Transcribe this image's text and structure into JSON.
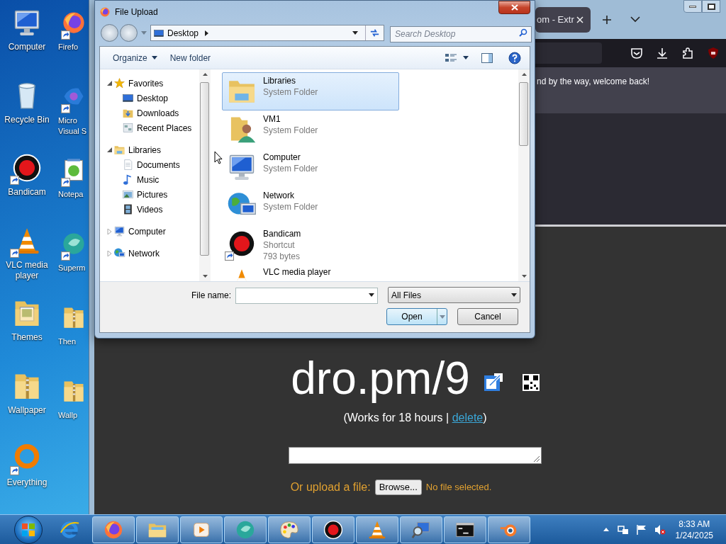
{
  "desktop": {
    "icons": [
      {
        "label": "Computer",
        "kind": "computer",
        "shortcut": false
      },
      {
        "label": "Recycle Bin",
        "kind": "recycle",
        "shortcut": false
      },
      {
        "label": "Bandicam",
        "kind": "bandicam",
        "shortcut": true
      },
      {
        "label": "VLC media player",
        "kind": "vlc",
        "shortcut": true
      },
      {
        "label": "Themes",
        "kind": "photo-folder",
        "shortcut": false
      },
      {
        "label": "Wallpaper",
        "kind": "zip-folder",
        "shortcut": false
      },
      {
        "label": "Everything",
        "kind": "everything",
        "shortcut": true
      }
    ],
    "partial_icons": [
      {
        "label": "Firefo",
        "kind": "firefox",
        "shortcut": true
      },
      {
        "label": "Micro Visual S",
        "kind": "vscode",
        "shortcut": true
      },
      {
        "label": "Notepa",
        "kind": "notepad",
        "shortcut": true
      },
      {
        "label": "Superm",
        "kind": "supermium",
        "shortcut": true
      },
      {
        "label": "Then",
        "kind": "zip-folder",
        "shortcut": false
      },
      {
        "label": "Wallp",
        "kind": "zip-folder",
        "shortcut": false
      }
    ]
  },
  "browser": {
    "tab": {
      "title": "om - Extr"
    },
    "notification": "nd by the way, welcome back!",
    "page": {
      "short_link": "dro.pm/9",
      "expiry_prefix": "(Works for 18 hours | ",
      "delete_link": "delete",
      "expiry_suffix": ")",
      "upload_label": "Or upload a file:",
      "browse_button": "Browse...",
      "file_status": "No file selected."
    }
  },
  "dialog": {
    "title": "File Upload",
    "location": "Desktop",
    "search_placeholder": "Search Desktop",
    "toolbar": [
      {
        "label": "Organize",
        "has_menu": true
      },
      {
        "label": "New folder",
        "has_menu": false
      }
    ],
    "nav": [
      {
        "label": "Favorites",
        "kind": "star",
        "expanded": true,
        "children": [
          {
            "label": "Desktop",
            "kind": "desktop"
          },
          {
            "label": "Downloads",
            "kind": "downloads"
          },
          {
            "label": "Recent Places",
            "kind": "recent"
          }
        ]
      },
      {
        "label": "Libraries",
        "kind": "library",
        "expanded": true,
        "children": [
          {
            "label": "Documents",
            "kind": "documents"
          },
          {
            "label": "Music",
            "kind": "music"
          },
          {
            "label": "Pictures",
            "kind": "pictures"
          },
          {
            "label": "Videos",
            "kind": "videos"
          }
        ]
      },
      {
        "label": "Computer",
        "kind": "computer",
        "expanded": false
      },
      {
        "label": "Network",
        "kind": "network",
        "expanded": false
      }
    ],
    "files": [
      {
        "name": "Libraries",
        "details": [
          "System Folder"
        ],
        "kind": "library",
        "shortcut": false,
        "selected": true
      },
      {
        "name": "VM1",
        "details": [
          "System Folder"
        ],
        "kind": "user-folder",
        "shortcut": false,
        "selected": false
      },
      {
        "name": "Computer",
        "details": [
          "System Folder"
        ],
        "kind": "computer",
        "shortcut": false,
        "selected": false
      },
      {
        "name": "Network",
        "details": [
          "System Folder"
        ],
        "kind": "network",
        "shortcut": false,
        "selected": false
      },
      {
        "name": "Bandicam",
        "details": [
          "Shortcut",
          "793 bytes"
        ],
        "kind": "bandicam",
        "shortcut": true,
        "selected": false
      },
      {
        "name": "VLC media player",
        "kind": "vlc",
        "shortcut": false,
        "selected": false
      }
    ],
    "file_name_label": "File name:",
    "file_type": "All Files",
    "buttons": [
      {
        "label": "Open",
        "kind": "split"
      },
      {
        "label": "Cancel",
        "kind": "plain"
      }
    ]
  },
  "taskbar": {
    "apps": [
      {
        "kind": "ie",
        "running": false
      },
      {
        "kind": "firefox",
        "running": true
      },
      {
        "kind": "explorer",
        "running": true
      },
      {
        "kind": "media",
        "running": true
      },
      {
        "kind": "supermium",
        "running": true
      },
      {
        "kind": "paint",
        "running": true
      },
      {
        "kind": "bandicam",
        "running": true
      },
      {
        "kind": "vlc",
        "running": true
      },
      {
        "kind": "network-tool",
        "running": true
      },
      {
        "kind": "cmd",
        "running": true
      },
      {
        "kind": "blender",
        "running": true
      }
    ],
    "clock": {
      "time": "8:33 AM",
      "date": "1/24/2025"
    }
  }
}
